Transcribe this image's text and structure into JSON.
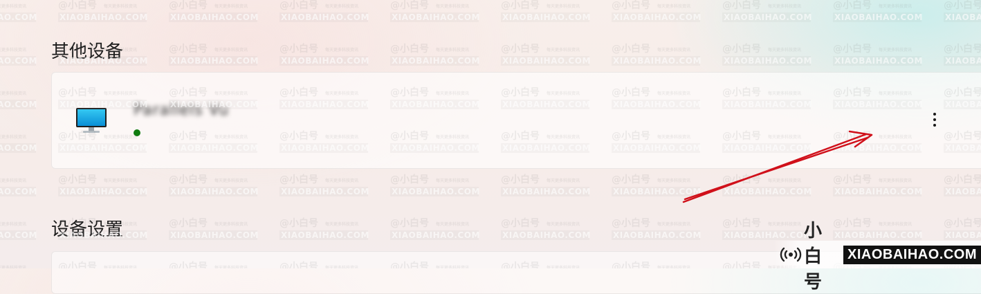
{
  "sections": {
    "other_devices_title": "其他设备",
    "device_settings_title": "设备设置"
  },
  "device": {
    "name": "Parallels Vu",
    "icon": "monitor-icon",
    "status": "online",
    "status_color": "#107c10",
    "more_icon": "more-options-icon"
  },
  "watermark": {
    "brand_cn": "小白号",
    "brand_en": "XIAOBAIHAO.COM",
    "tile_top": "@小白号",
    "tile_small": "每天更多科技资讯",
    "tile_bottom": "XIAOBAIHAO.COM"
  },
  "annotation": {
    "color": "#d0101a",
    "type": "arrow"
  }
}
